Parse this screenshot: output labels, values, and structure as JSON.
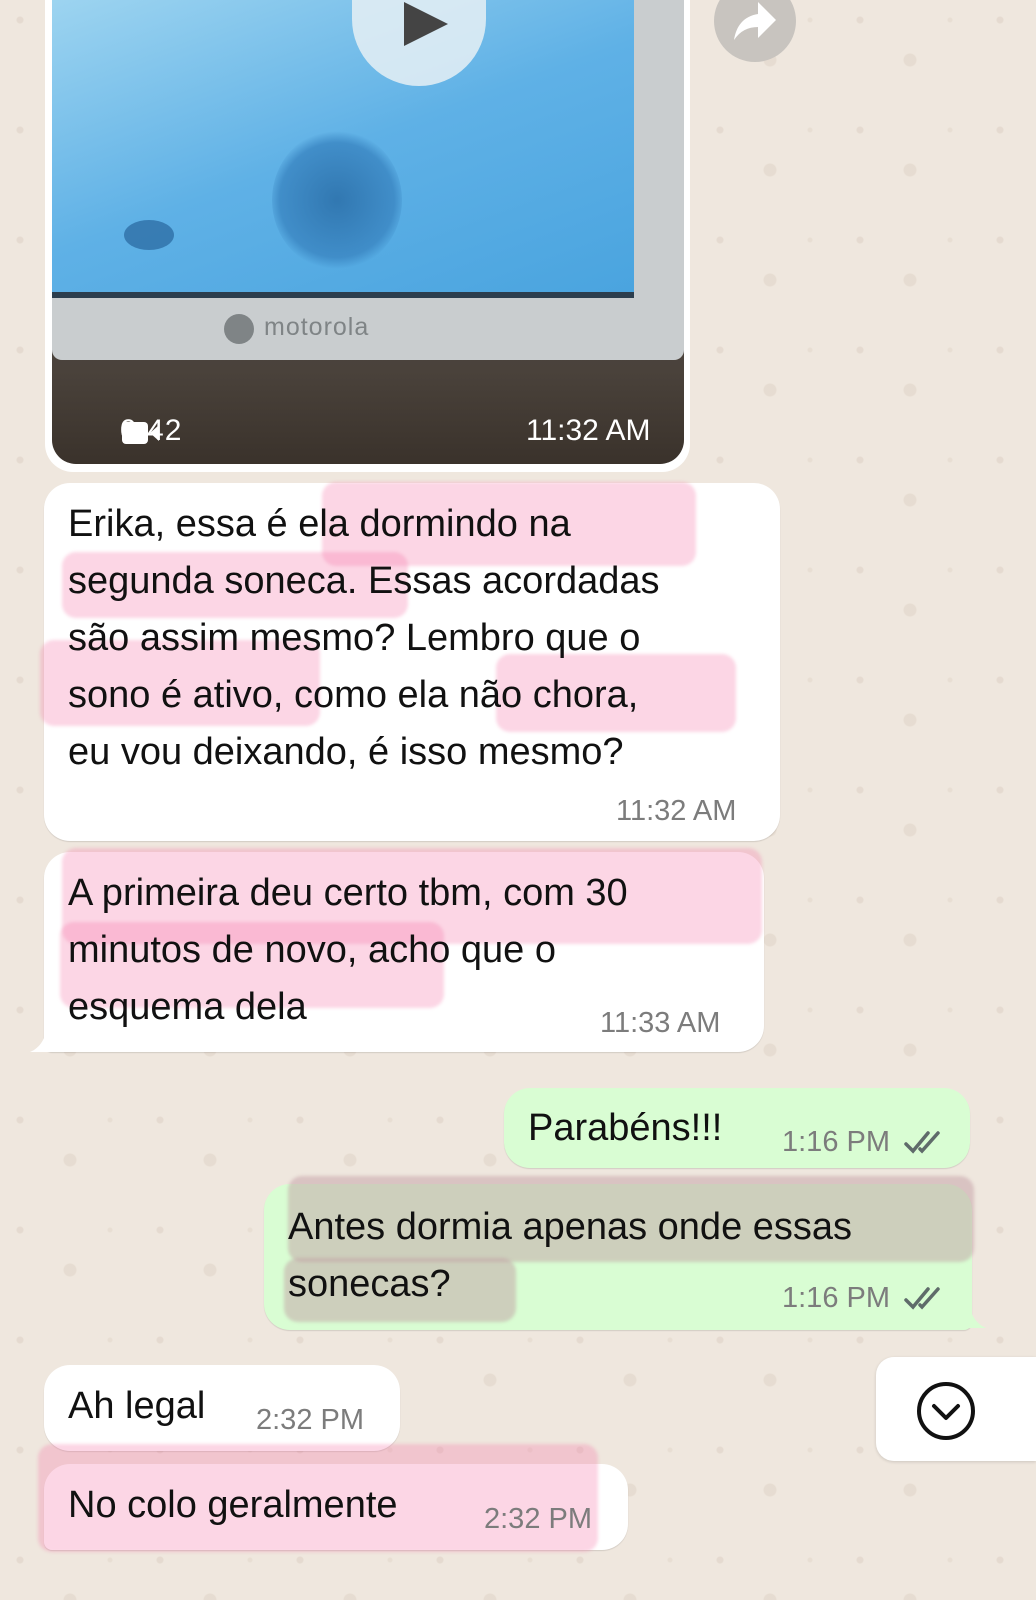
{
  "video": {
    "brand": "motorola",
    "duration": "0:42",
    "time": "11:32 AM",
    "icons": [
      "play-icon",
      "video-camera-icon",
      "forward-icon"
    ]
  },
  "messages": [
    {
      "direction": "incoming",
      "lines": [
        "Erika, essa é ela dormindo na",
        "segunda soneca. Essas acordadas",
        "são assim mesmo? Lembro que o",
        "sono é ativo, como ela não chora,",
        "eu vou deixando, é isso mesmo?"
      ],
      "time": "11:32 AM"
    },
    {
      "direction": "incoming",
      "lines": [
        "A primeira deu certo tbm, com 30",
        "minutos de novo, acho que o",
        "esquema dela"
      ],
      "time": "11:33 AM"
    },
    {
      "direction": "outgoing",
      "lines": [
        "Parabéns!!!"
      ],
      "time": "1:16 PM",
      "status": "read"
    },
    {
      "direction": "outgoing",
      "lines": [
        "Antes dormia apenas onde essas",
        "sonecas?"
      ],
      "time": "1:16 PM",
      "status": "read"
    },
    {
      "direction": "incoming",
      "lines": [
        "Ah legal"
      ],
      "time": "2:32 PM"
    },
    {
      "direction": "incoming",
      "lines": [
        "No colo geralmente"
      ],
      "time": "2:32 PM"
    }
  ],
  "scroll_button": {
    "icon": "chevron-down-icon"
  },
  "colors": {
    "wallpaper": "#efe7de",
    "incoming_bubble": "#ffffff",
    "outgoing_bubble": "#d9fdd3",
    "read_ticks": "#5f6b6a",
    "highlighter": "#f478aa"
  }
}
